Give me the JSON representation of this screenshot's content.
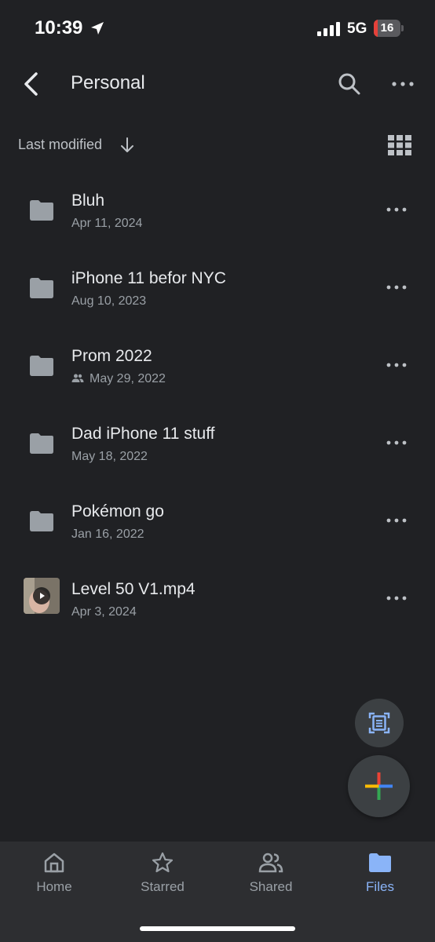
{
  "status_bar": {
    "time": "10:39",
    "network": "5G",
    "battery": "16",
    "battery_level": 0.16
  },
  "header": {
    "title": "Personal"
  },
  "sort": {
    "label": "Last modified"
  },
  "files": [
    {
      "name": "Bluh",
      "date": "Apr 11, 2024",
      "type": "folder",
      "shared": false
    },
    {
      "name": "iPhone 11 befor NYC",
      "date": "Aug 10, 2023",
      "type": "folder",
      "shared": false
    },
    {
      "name": "Prom 2022",
      "date": "May 29, 2022",
      "type": "folder",
      "shared": true
    },
    {
      "name": "Dad iPhone 11 stuff",
      "date": "May 18, 2022",
      "type": "folder",
      "shared": false
    },
    {
      "name": "Pokémon go",
      "date": "Jan 16, 2022",
      "type": "folder",
      "shared": false
    },
    {
      "name": "Level 50 V1.mp4",
      "date": "Apr 3, 2024",
      "type": "video",
      "shared": false
    }
  ],
  "bottom_nav": {
    "items": [
      {
        "label": "Home",
        "icon": "home-icon",
        "active": false
      },
      {
        "label": "Starred",
        "icon": "star-icon",
        "active": false
      },
      {
        "label": "Shared",
        "icon": "shared-icon",
        "active": false
      },
      {
        "label": "Files",
        "icon": "folder-icon",
        "active": true
      }
    ]
  },
  "colors": {
    "background": "#202124",
    "accent": "#8ab4f8",
    "battery_low": "#e5413a"
  }
}
